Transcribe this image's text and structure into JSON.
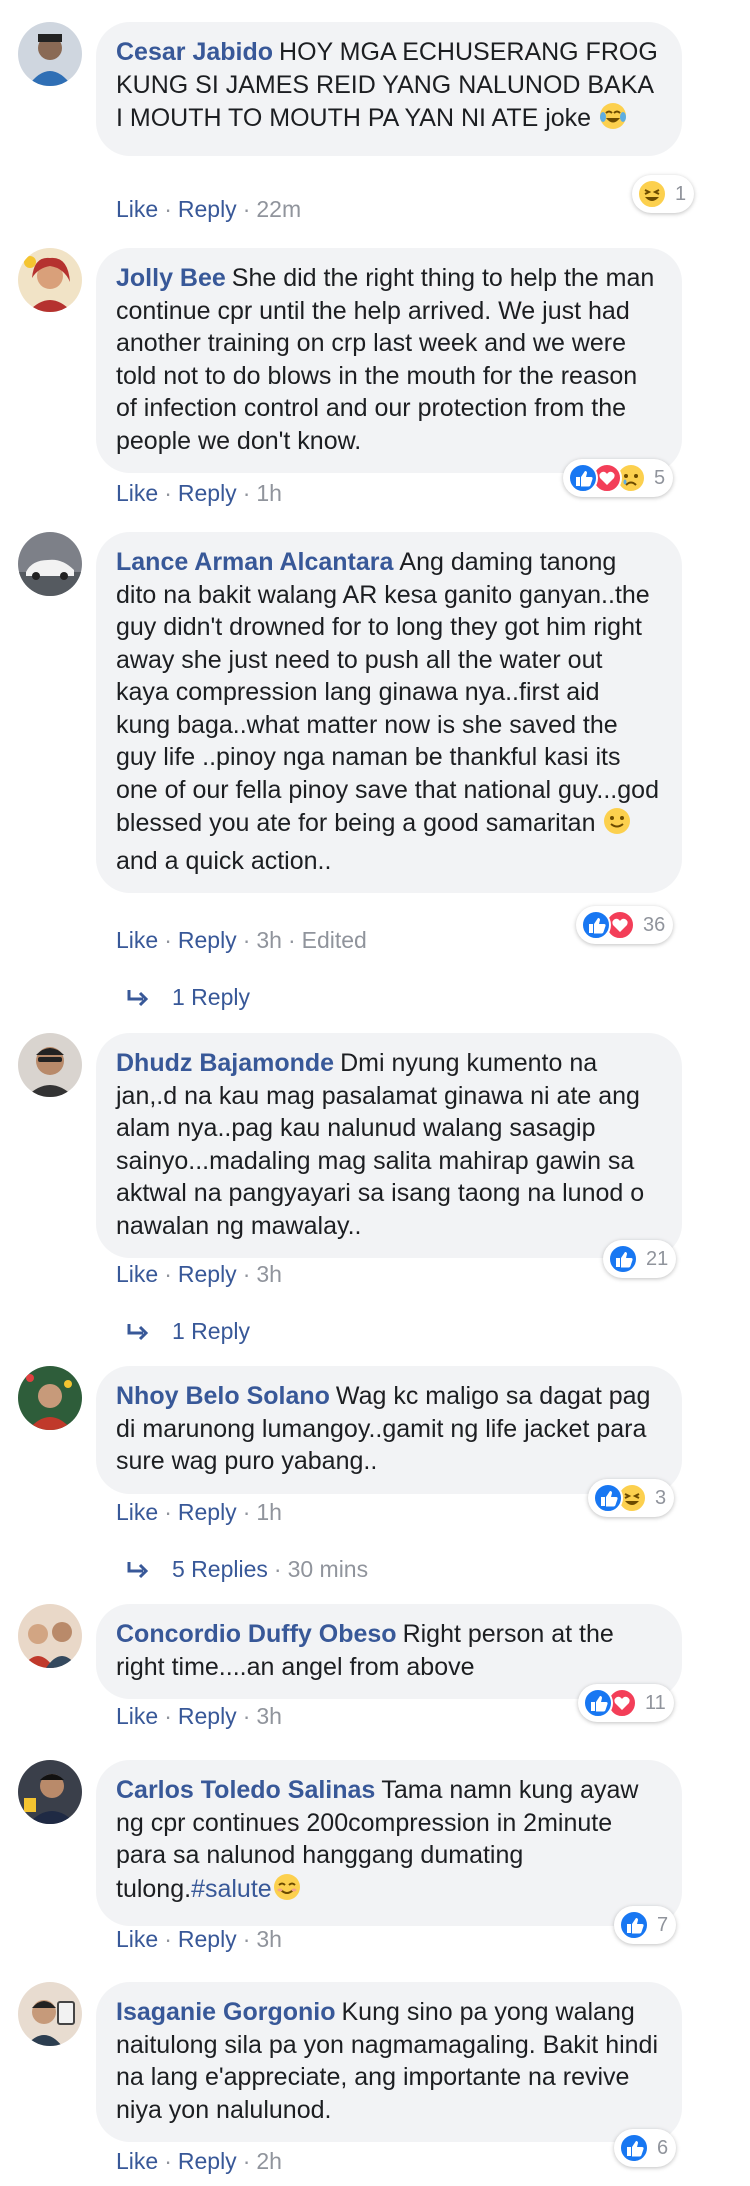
{
  "labels": {
    "like": "Like",
    "reply": "Reply",
    "dot": "·"
  },
  "colors": {
    "link": "#385898",
    "meta": "#90949c",
    "bubble": "#f2f3f5",
    "like_blue": "#1877f2",
    "love_red": "#f33e58",
    "haha_yellow": "#fcd04e"
  },
  "comments": [
    {
      "author": "Cesar Jabido",
      "text": "HOY MGA ECHUSERANG FROG KUNG SI JAMES REID YANG NALUNOD BAKA I MOUTH TO MOUTH PA YAN NI ATE joke",
      "trailing_emoji": "tears-of-joy-emoji",
      "time": "22m",
      "reactions": [
        "haha-reaction-icon"
      ],
      "reaction_count": "1"
    },
    {
      "author": "Jolly Bee",
      "text": "She did the right thing to help the man continue cpr until the help arrived. We just had another training on crp last week and we were told not to do blows in the mouth for the reason of infection control and our protection from the people we don't know.",
      "time": "1h",
      "reactions": [
        "like-reaction-icon",
        "love-reaction-icon",
        "sad-reaction-icon"
      ],
      "reaction_count": "5"
    },
    {
      "author": "Lance Arman Alcantara",
      "text_before": "Ang daming tanong dito na bakit walang AR kesa ganito ganyan..the guy didn't drowned for to long they got him right away she just need to push all the water out kaya compression lang ginawa nya..first aid kung baga..what matter now is she saved the guy life ..pinoy nga naman be thankful kasi its one of our fella pinoy save that national guy...god blessed you ate for being a good samaritan ",
      "inline_emoji": "smile-emoji",
      "text_after": " and a quick action..",
      "time": "3h",
      "edited": "Edited",
      "reactions": [
        "like-reaction-icon",
        "love-reaction-icon"
      ],
      "reaction_count": "36",
      "replies": "1 Reply"
    },
    {
      "author": "Dhudz Bajamonde",
      "text": "Dmi nyung kumento na jan,.d na kau mag pasalamat ginawa ni ate ang alam nya..pag kau nalunud walang sasagip sainyo...madaling mag salita mahirap gawin sa aktwal na pangyayari sa isang taong na lunod o nawalan ng mawalay..",
      "time": "3h",
      "reactions": [
        "like-reaction-icon"
      ],
      "reaction_count": "21",
      "replies": "1 Reply"
    },
    {
      "author": "Nhoy Belo Solano",
      "text": "Wag kc maligo sa dagat pag di marunong lumangoy..gamit ng life jacket para sure wag puro yabang..",
      "time": "1h",
      "reactions": [
        "like-reaction-icon",
        "haha-reaction-icon"
      ],
      "reaction_count": "3",
      "replies": "5 Replies",
      "replies_time": "30 mins"
    },
    {
      "author": "Concordio Duffy Obeso",
      "text": "Right person at the right time....an angel from above",
      "time": "3h",
      "reactions": [
        "like-reaction-icon",
        "love-reaction-icon"
      ],
      "reaction_count": "11"
    },
    {
      "author": "Carlos Toledo Salinas",
      "text": "Tama namn kung ayaw ng cpr continues 200compression in 2minute para sa nalunod hanggang dumating tulong.",
      "hashtag": "#salute",
      "trailing_emoji": "smiling-eyes-emoji",
      "time": "3h",
      "reactions": [
        "like-reaction-icon"
      ],
      "reaction_count": "7"
    },
    {
      "author": "Isaganie Gorgonio",
      "text": "Kung sino pa yong walang naitulong sila pa yon nagmamagaling. Bakit hindi na lang e'appreciate, ang importante na revive niya yon nalulunod.",
      "time": "2h",
      "reactions": [
        "like-reaction-icon"
      ],
      "reaction_count": "6"
    }
  ]
}
